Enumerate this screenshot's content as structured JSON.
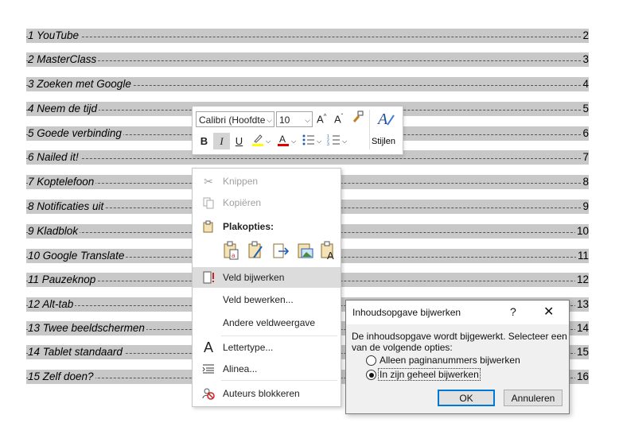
{
  "toc": [
    {
      "title": "1 YouTube",
      "page": "2"
    },
    {
      "title": "2 MasterClass",
      "page": "3"
    },
    {
      "title": "3 Zoeken met Google",
      "page": "4"
    },
    {
      "title": "4 Neem de tijd",
      "page": "5"
    },
    {
      "title": "5 Goede verbinding",
      "page": "6"
    },
    {
      "title": "6 Nailed it!",
      "page": "7"
    },
    {
      "title": "7 Koptelefoon",
      "page": "8"
    },
    {
      "title": "8 Notificaties uit",
      "page": "9"
    },
    {
      "title": "9 Kladblok",
      "page": "10"
    },
    {
      "title": "10 Google Translate",
      "page": "11"
    },
    {
      "title": "11 Pauzeknop",
      "page": "12"
    },
    {
      "title": "12 Alt-tab",
      "page": "13"
    },
    {
      "title": "13 Twee beeldschermen",
      "page": "14"
    },
    {
      "title": "14 Tablet standaard",
      "page": "15"
    },
    {
      "title": "15 Zelf doen?",
      "page": "16"
    }
  ],
  "minitoolbar": {
    "font_name": "Calibri (Hoofdte",
    "font_size": "10",
    "bold": "B",
    "italic": "I",
    "underline": "U",
    "styles_label": "Stijlen",
    "highlight_color": "#ffff00",
    "font_color": "#e00000"
  },
  "context_menu": {
    "knippen": "Knippen",
    "kopieren": "Kopiëren",
    "plakopties": "Plakopties:",
    "veld_bijwerken": "Veld bijwerken",
    "veld_bewerken": "Veld bewerken...",
    "andere_veldweergave": "Andere veldweergave",
    "lettertype": "Lettertype...",
    "alinea": "Alinea...",
    "auteurs_blokkeren": "Auteurs blokkeren"
  },
  "dialog": {
    "title": "Inhoudsopgave bijwerken",
    "help": "?",
    "close": "✕",
    "message_line1": "De inhoudsopgave wordt bijgewerkt. Selecteer een",
    "message_line2": "van de volgende opties:",
    "option_pages": "Alleen paginanummers bijwerken",
    "option_full": "In zijn geheel bijwerken",
    "selected_option": "full",
    "ok": "OK",
    "cancel": "Annuleren"
  }
}
